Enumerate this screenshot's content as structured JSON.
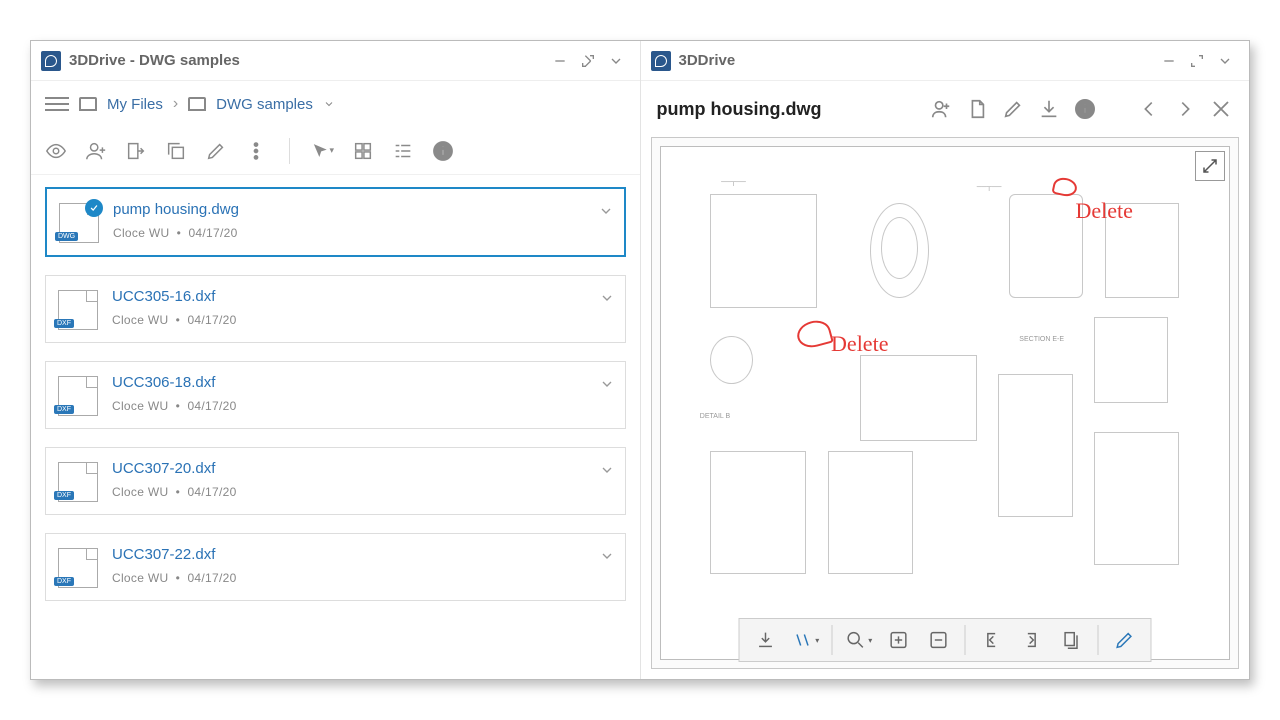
{
  "left": {
    "title": "3DDrive - DWG samples",
    "breadcrumb": {
      "root": "My Files",
      "current": "DWG samples"
    },
    "files": [
      {
        "name": "pump housing.dwg",
        "author": "Cloce WU",
        "date": "04/17/20",
        "selected": true,
        "ext": "DWG"
      },
      {
        "name": "UCC305-16.dxf",
        "author": "Cloce WU",
        "date": "04/17/20",
        "selected": false,
        "ext": "DXF"
      },
      {
        "name": "UCC306-18.dxf",
        "author": "Cloce WU",
        "date": "04/17/20",
        "selected": false,
        "ext": "DXF"
      },
      {
        "name": "UCC307-20.dxf",
        "author": "Cloce WU",
        "date": "04/17/20",
        "selected": false,
        "ext": "DXF"
      },
      {
        "name": "UCC307-22.dxf",
        "author": "Cloce WU",
        "date": "04/17/20",
        "selected": false,
        "ext": "DXF"
      }
    ]
  },
  "right": {
    "title": "3DDrive",
    "file": "pump housing.dwg",
    "annotations": [
      {
        "text": "Delete"
      },
      {
        "text": "Delete"
      }
    ]
  },
  "icons": {
    "minimize": "minimize",
    "expand": "expand",
    "collapse": "collapse"
  }
}
